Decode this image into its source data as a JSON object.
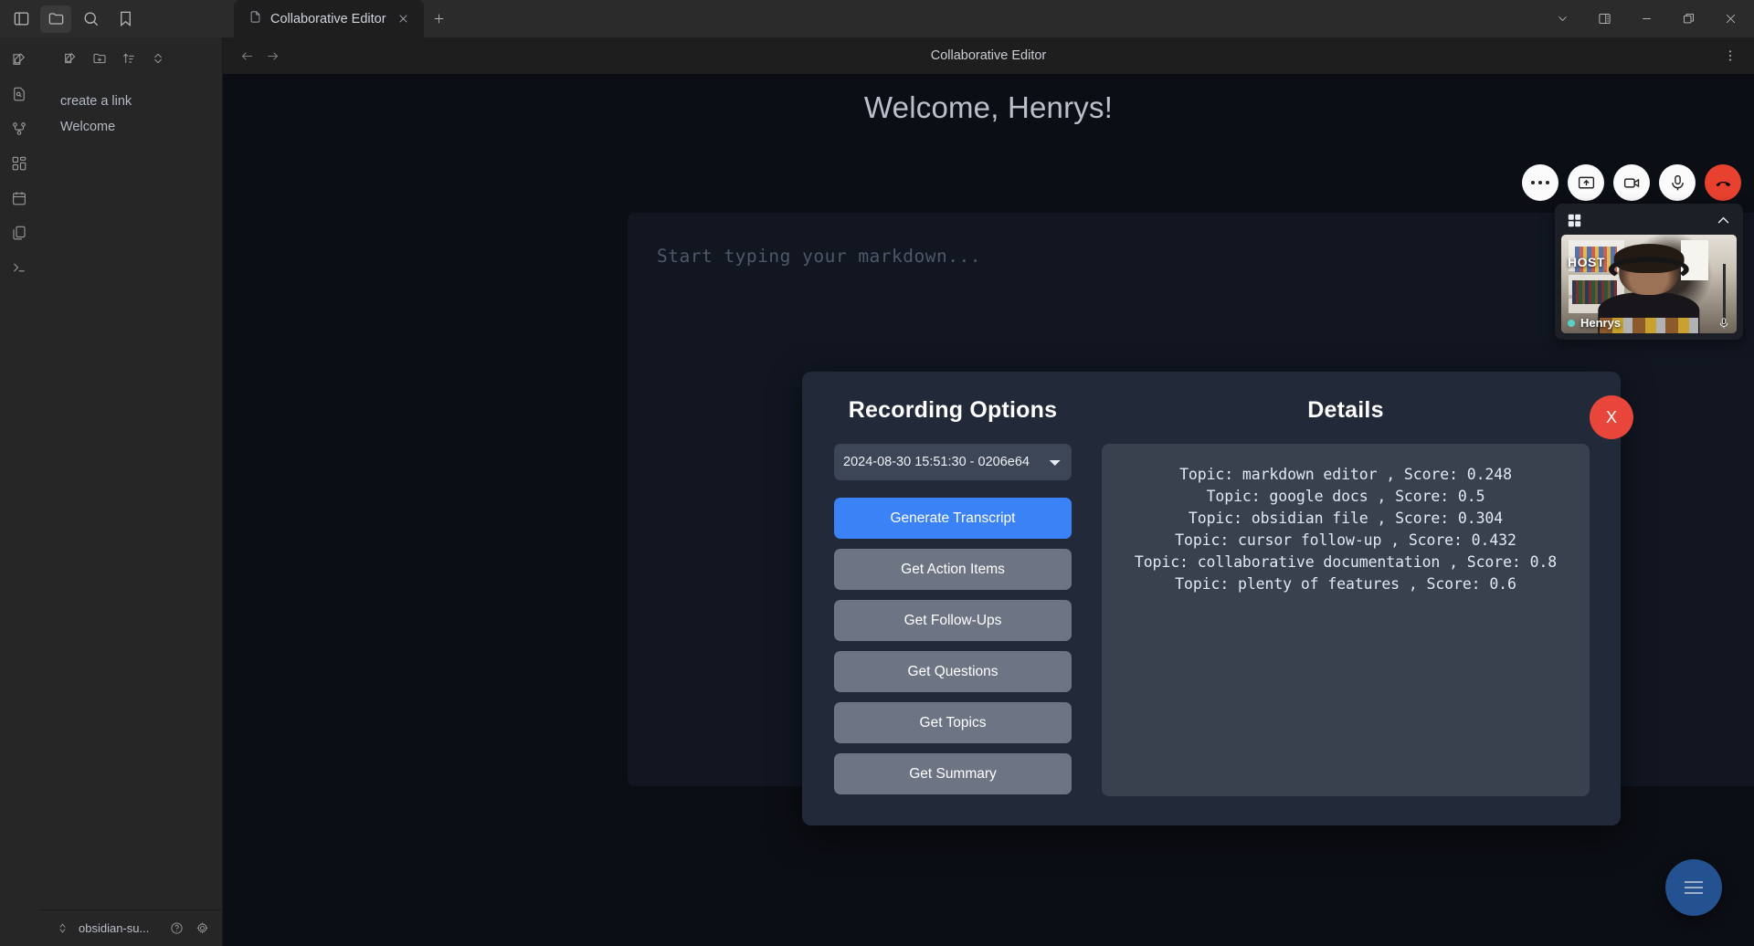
{
  "titlebar": {
    "left_icons": [
      {
        "name": "toggle-sidebar-icon",
        "label": "Toggle sidebar"
      },
      {
        "name": "folder-icon",
        "label": "Files"
      },
      {
        "name": "search-icon",
        "label": "Search"
      },
      {
        "name": "bookmark-icon",
        "label": "Bookmarks"
      }
    ],
    "tab": {
      "title": "Collaborative Editor",
      "close_label": "Close tab"
    },
    "new_tab_label": "New tab",
    "window_controls": [
      {
        "name": "chevron-down-icon",
        "label": "More"
      },
      {
        "name": "right-sidebar-icon",
        "label": "Toggle right sidebar"
      },
      {
        "name": "minimize-icon",
        "label": "Minimize"
      },
      {
        "name": "maximize-icon",
        "label": "Restore"
      },
      {
        "name": "close-icon",
        "label": "Close"
      }
    ]
  },
  "ribbon": {
    "items": [
      {
        "name": "new-note-icon",
        "label": "New note"
      },
      {
        "name": "quick-switcher-icon",
        "label": "Quick switcher"
      },
      {
        "name": "graph-view-icon",
        "label": "Graph view"
      },
      {
        "name": "canvas-icon",
        "label": "Canvas"
      },
      {
        "name": "daily-note-icon",
        "label": "Daily note"
      },
      {
        "name": "templates-icon",
        "label": "Templates"
      },
      {
        "name": "command-palette-icon",
        "label": "Terminal"
      }
    ]
  },
  "filepane": {
    "toolbar": [
      {
        "name": "new-note-icon",
        "label": "New note"
      },
      {
        "name": "new-folder-icon",
        "label": "New folder"
      },
      {
        "name": "sort-icon",
        "label": "Change sort order"
      },
      {
        "name": "collapse-icon",
        "label": "Collapse all"
      }
    ],
    "files": [
      {
        "label": "create a link"
      },
      {
        "label": "Welcome"
      }
    ],
    "status": {
      "vault_name": "obsidian-su...",
      "help_label": "Help",
      "settings_label": "Settings"
    }
  },
  "view": {
    "back_label": "Back",
    "forward_label": "Forward",
    "title": "Collaborative Editor",
    "menu_label": "More options"
  },
  "editor": {
    "welcome_heading": "Welcome, Henrys!",
    "placeholder": "Start typing your markdown..."
  },
  "call": {
    "controls": [
      {
        "name": "more-options-icon",
        "label": "More options"
      },
      {
        "name": "share-screen-icon",
        "label": "Share screen"
      },
      {
        "name": "camera-icon",
        "label": "Toggle camera"
      },
      {
        "name": "microphone-icon",
        "label": "Toggle microphone"
      },
      {
        "name": "end-call-icon",
        "label": "End call"
      }
    ],
    "panel": {
      "layout_label": "Change layout",
      "collapse_label": "Collapse",
      "participant": {
        "badge": "HOST",
        "name": "Henrys",
        "mic_state": "microphone-icon"
      }
    }
  },
  "modal": {
    "close_label": "X",
    "left": {
      "heading": "Recording Options",
      "select_value": "2024-08-30 15:51:30 - 0206e64",
      "select_options": [
        "2024-08-30 15:51:30 - 0206e64"
      ],
      "buttons": [
        {
          "label": "Generate Transcript",
          "variant": "primary"
        },
        {
          "label": "Get Action Items",
          "variant": "secondary"
        },
        {
          "label": "Get Follow-Ups",
          "variant": "secondary"
        },
        {
          "label": "Get Questions",
          "variant": "secondary"
        },
        {
          "label": "Get Topics",
          "variant": "secondary"
        },
        {
          "label": "Get Summary",
          "variant": "secondary"
        }
      ]
    },
    "right": {
      "heading": "Details",
      "lines": [
        "Topic: markdown editor , Score: 0.248",
        "Topic: google docs , Score: 0.5",
        "Topic: obsidian file , Score: 0.304",
        "Topic: cursor follow-up , Score: 0.432",
        "Topic: collaborative documentation , Score: 0.8",
        "Topic: plenty of features , Score: 0.6"
      ]
    }
  },
  "fab": {
    "name": "menu-fab",
    "label": "Menu"
  },
  "colors": {
    "accent_blue": "#3b82f6",
    "danger_red": "#e8463a",
    "modal_bg": "#222938",
    "details_bg": "#39414f",
    "fab_blue": "#24518f"
  }
}
